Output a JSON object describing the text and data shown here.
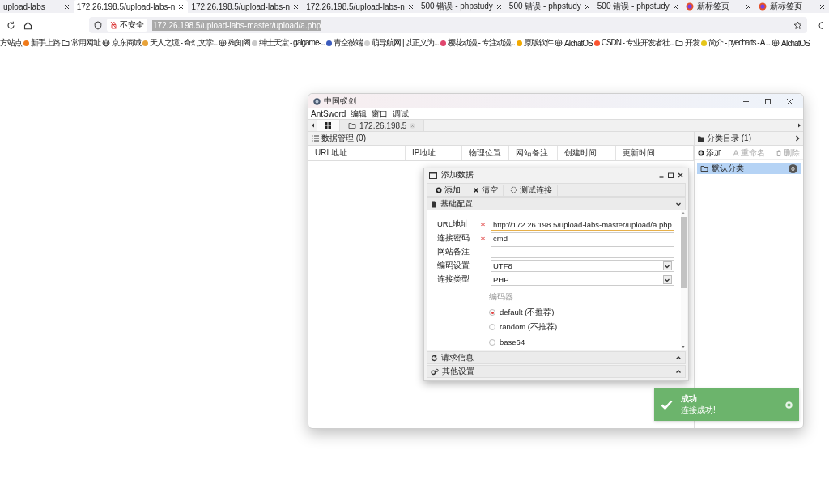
{
  "browser": {
    "tabs": [
      {
        "title": "upload-labs",
        "selected": false,
        "kind": "page"
      },
      {
        "title": "172.26.198.5/upload-labs-n",
        "selected": true,
        "kind": "page"
      },
      {
        "title": "172.26.198.5/upload-labs-n",
        "selected": false,
        "kind": "page"
      },
      {
        "title": "172.26.198.5/upload-labs-n",
        "selected": false,
        "kind": "page"
      },
      {
        "title": "500 错误 - phpstudy",
        "selected": false,
        "kind": "page"
      },
      {
        "title": "500 错误 - phpstudy",
        "selected": false,
        "kind": "page"
      },
      {
        "title": "500 错误 - phpstudy",
        "selected": false,
        "kind": "page"
      },
      {
        "title": "新标签页",
        "selected": false,
        "kind": "new_tab"
      },
      {
        "title": "新标签页",
        "selected": false,
        "kind": "new_tab"
      }
    ],
    "address": {
      "security": "不安全",
      "url": "172.26.198.5/upload-labs-master/upload/a.php"
    },
    "bookmarks": [
      {
        "label": "方站点",
        "kind": "text"
      },
      {
        "label": "新手上路",
        "kind": "site",
        "color": "#f07a1a"
      },
      {
        "label": "常用网址",
        "kind": "folder"
      },
      {
        "label": "京东商城",
        "kind": "globe"
      },
      {
        "label": "天人之境 - 奇幻文学...",
        "kind": "site",
        "color": "#e8a33a"
      },
      {
        "label": "殉知阁",
        "kind": "globe"
      },
      {
        "label": "绅士天堂 - galgame-...",
        "kind": "site",
        "color": "#c9c9c9"
      },
      {
        "label": "青空彼端",
        "kind": "site",
        "color": "#3b5bbd"
      },
      {
        "label": "萌导航网 | 以正义为...",
        "kind": "site",
        "color": "#d0d0d0"
      },
      {
        "label": "樱花动漫 - 专注动漫...",
        "kind": "site",
        "color": "#e0466e"
      },
      {
        "label": "原版软件",
        "kind": "site",
        "color": "#f2a900"
      },
      {
        "label": "AIchatOS",
        "kind": "globe"
      },
      {
        "label": "CSDN - 专业开发者社...",
        "kind": "site",
        "color": "#fc5531"
      },
      {
        "label": "开发",
        "kind": "folder"
      },
      {
        "label": "简介 - pyecharts - A ...",
        "kind": "site",
        "color": "#e6c619"
      },
      {
        "label": "AIchatOS",
        "kind": "globe"
      }
    ]
  },
  "antsword": {
    "title": "中国蚁剑",
    "menu": [
      "AntSword",
      "编辑",
      "窗口",
      "调试"
    ],
    "tabs": [
      {
        "kind": "home",
        "selected": true
      },
      {
        "kind": "shell",
        "label": "172.26.198.5",
        "selected": false
      }
    ],
    "data_panel": {
      "title": "数据管理 (0)",
      "columns": [
        "URL地址",
        "IP地址",
        "物理位置",
        "网站备注",
        "创建时间",
        "更新时间"
      ]
    },
    "category_panel": {
      "title": "分类目录 (1)",
      "toolbar": [
        {
          "label": "添加",
          "kind": "add",
          "disabled": false
        },
        {
          "label": "重命名",
          "kind": "rename",
          "disabled": true
        },
        {
          "label": "删除",
          "kind": "delete",
          "disabled": true
        }
      ],
      "items": [
        {
          "label": "默认分类",
          "count": "0",
          "selected": true
        }
      ]
    },
    "dialog": {
      "title": "添加数据",
      "toolbar": [
        {
          "label": "添加",
          "kind": "add"
        },
        {
          "label": "清空",
          "kind": "clear"
        },
        {
          "label": "测试连接",
          "kind": "test"
        }
      ],
      "sections": [
        {
          "title": "基础配置",
          "kind": "basic",
          "expanded": true
        },
        {
          "title": "请求信息",
          "kind": "request",
          "expanded": false
        },
        {
          "title": "其他设置",
          "kind": "other",
          "expanded": false
        }
      ],
      "fields": [
        {
          "label": "URL地址",
          "kind": "text",
          "required": true,
          "focused": true,
          "value": "http://172.26.198.5/upload-labs-master/upload/a.php"
        },
        {
          "label": "连接密码",
          "kind": "text",
          "required": true,
          "focused": false,
          "value": "cmd"
        },
        {
          "label": "网站备注",
          "kind": "text",
          "required": false,
          "focused": false
        },
        {
          "label": "编码设置",
          "kind": "select",
          "required": false,
          "focused": false,
          "value": "UTF8"
        },
        {
          "label": "连接类型",
          "kind": "select",
          "required": false,
          "focused": false,
          "value": "PHP"
        }
      ],
      "encoder": {
        "label": "编码器",
        "options": [
          {
            "label": "default (不推荐)",
            "selected": true
          },
          {
            "label": "random (不推荐)",
            "selected": false
          },
          {
            "label": "base64",
            "selected": false
          }
        ]
      }
    }
  },
  "toast": {
    "title": "成功",
    "message": "连接成功!"
  }
}
